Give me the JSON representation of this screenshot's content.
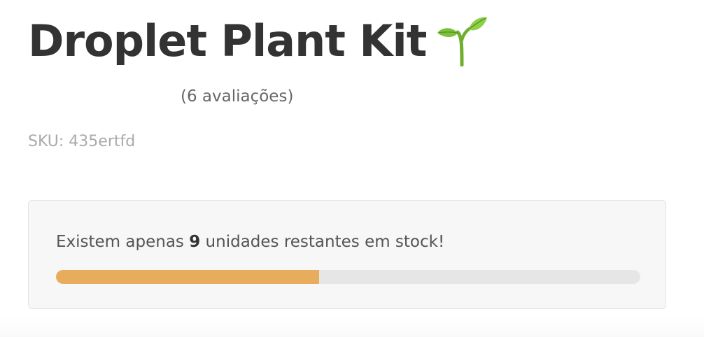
{
  "product": {
    "title": "Droplet Plant Kit",
    "title_icon": "seedling-icon",
    "reviews_label": "(6 avaliações)",
    "sku_label": "SKU: 435ertfd"
  },
  "stock": {
    "message_prefix": "Existem apenas ",
    "units_left": "9",
    "message_suffix": " unidades restantes em stock!",
    "progress_fraction": 0.45,
    "bar_color": "#e8ad5c",
    "track_color": "#e6e6e6"
  }
}
